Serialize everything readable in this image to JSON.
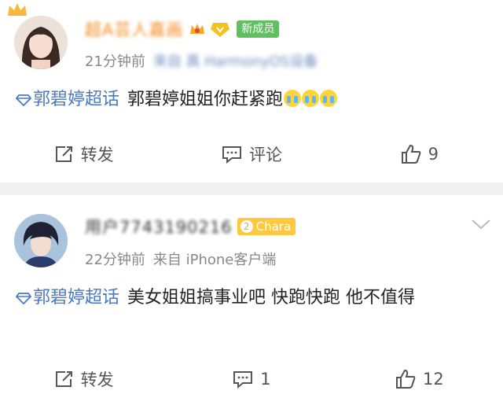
{
  "posts": [
    {
      "author": "超A芸人嘉画",
      "member_badge": "新成员",
      "time": "21分钟前",
      "source": "来自 真 HarmonyOS设备",
      "topic": "郭碧婷超话",
      "text": "郭碧婷姐姐你赶紧跑",
      "emoji": "crying-emoji",
      "repost_label": "转发",
      "comment_label": "评论",
      "like_count": "9"
    },
    {
      "author": "用户7743190216",
      "badge_level": "2",
      "badge_label": "Chara",
      "time": "22分钟前",
      "source": "来自 iPhone客户端",
      "topic": "郭碧婷超话",
      "text": "美女姐姐搞事业吧 快跑快跑 他不值得",
      "repost_label": "转发",
      "comment_count": "1",
      "like_count": "12"
    }
  ],
  "colors": {
    "topic": "#4a79c7",
    "new_member_badge": "#5fbf61",
    "chara_badge": "#ffc83d",
    "meta": "#888888"
  }
}
